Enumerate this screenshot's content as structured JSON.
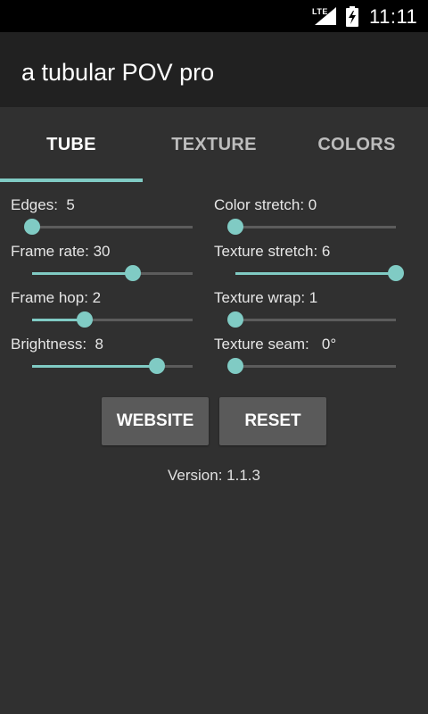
{
  "status_bar": {
    "network": "LTE",
    "time": "11:11"
  },
  "app": {
    "title": "a tubular POV pro"
  },
  "tabs": [
    {
      "label": "TUBE",
      "active": true
    },
    {
      "label": "TEXTURE",
      "active": false
    },
    {
      "label": "COLORS",
      "active": false
    }
  ],
  "settings": {
    "left": [
      {
        "label": "Edges:  5",
        "level": 0.0
      },
      {
        "label": "Frame rate: 30",
        "level": 0.63
      },
      {
        "label": "Frame hop: 2",
        "level": 0.33
      },
      {
        "label": "Brightness:  8",
        "level": 0.78
      }
    ],
    "right": [
      {
        "label": "Color stretch: 0",
        "level": 0.0
      },
      {
        "label": "Texture stretch: 6",
        "level": 1.0
      },
      {
        "label": "Texture wrap: 1",
        "level": 0.0
      },
      {
        "label": "Texture seam:   0°",
        "level": 0.0
      }
    ]
  },
  "buttons": {
    "website": "WEBSITE",
    "reset": "RESET"
  },
  "version_text": "Version: 1.1.3",
  "colors": {
    "accent": "#80cbc4",
    "background": "#303030",
    "app_bar": "#212121",
    "button": "#5a5a5a"
  }
}
